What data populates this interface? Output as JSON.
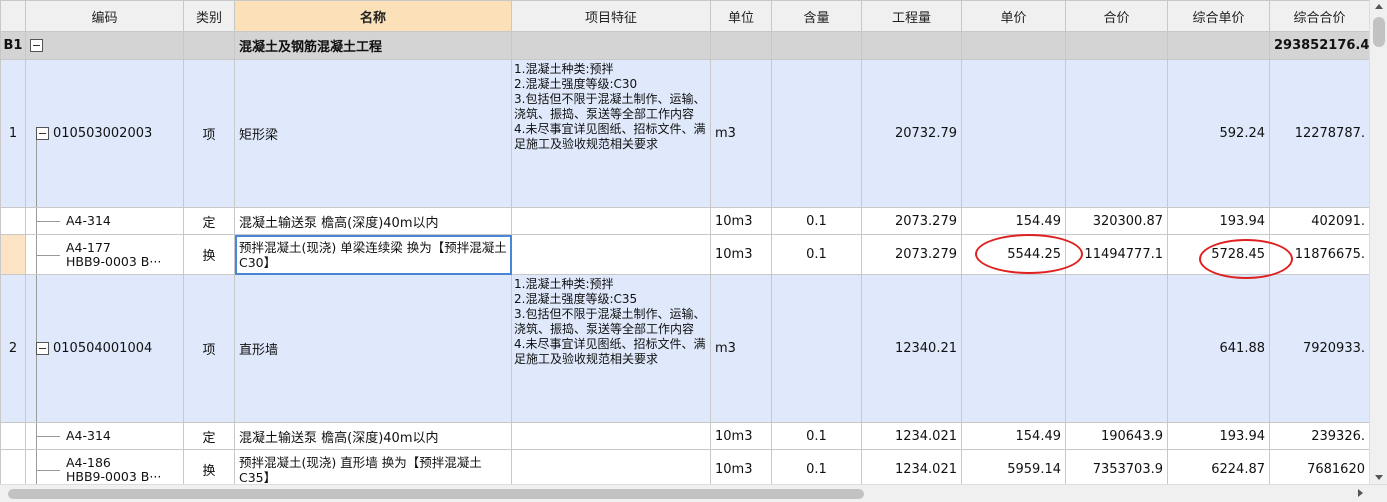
{
  "columns": {
    "code": "编码",
    "type": "类别",
    "name": "名称",
    "feature": "项目特征",
    "unit": "单位",
    "content": "含量",
    "qty": "工程量",
    "price": "单价",
    "total": "合价",
    "comp_price": "综合单价",
    "comp_total": "综合合价"
  },
  "section": {
    "no": "B1",
    "name": "混凝土及钢筋混凝土工程",
    "comp_total": "293852176.4"
  },
  "rows": [
    {
      "no": "1",
      "code": "010503002003",
      "type": "项",
      "name": "矩形梁",
      "feature": "1.混凝土种类:预拌\n2.混凝土强度等级:C30\n3.包括但不限于混凝土制作、运输、浇筑、振捣、泵送等全部工作内容\n4.未尽事宜详见图纸、招标文件、满足施工及验收规范相关要求",
      "unit": "m3",
      "content": "",
      "qty": "20732.79",
      "price": "",
      "total": "",
      "comp_price": "592.24",
      "comp_total": "12278787."
    },
    {
      "no": "",
      "code": "A4-314",
      "type": "定",
      "name": "混凝土输送泵 檐高(深度)40m以内",
      "unit": "10m3",
      "content": "0.1",
      "qty": "2073.279",
      "price": "154.49",
      "total": "320300.87",
      "comp_price": "193.94",
      "comp_total": "402091."
    },
    {
      "no": "",
      "code": "A4-177",
      "code2": "HBB9-0003 B···",
      "type": "换",
      "name": "预拌混凝土(现浇) 单梁连续梁  换为【预拌混凝土 C30】",
      "unit": "10m3",
      "content": "0.1",
      "qty": "2073.279",
      "price": "5544.25",
      "total": "11494777.1",
      "comp_price": "5728.45",
      "comp_total": "11876675."
    },
    {
      "no": "2",
      "code": "010504001004",
      "type": "项",
      "name": "直形墙",
      "feature": "1.混凝土种类:预拌\n2.混凝土强度等级:C35\n3.包括但不限于混凝土制作、运输、浇筑、振捣、泵送等全部工作内容\n4.未尽事宜详见图纸、招标文件、满足施工及验收规范相关要求",
      "unit": "m3",
      "content": "",
      "qty": "12340.21",
      "price": "",
      "total": "",
      "comp_price": "641.88",
      "comp_total": "7920933."
    },
    {
      "no": "",
      "code": "A4-314",
      "type": "定",
      "name": "混凝土输送泵 檐高(深度)40m以内",
      "unit": "10m3",
      "content": "0.1",
      "qty": "1234.021",
      "price": "154.49",
      "total": "190643.9",
      "comp_price": "193.94",
      "comp_total": "239326."
    },
    {
      "no": "",
      "code": "A4-186",
      "code2": "HBB9-0003 B···",
      "type": "换",
      "name": "预拌混凝土(现浇) 直形墙  换为【预拌混凝土 C35】",
      "unit": "10m3",
      "content": "0.1",
      "qty": "1234.021",
      "price": "5959.14",
      "total": "7353703.9",
      "comp_price": "6224.87",
      "comp_total": "7681620"
    }
  ]
}
